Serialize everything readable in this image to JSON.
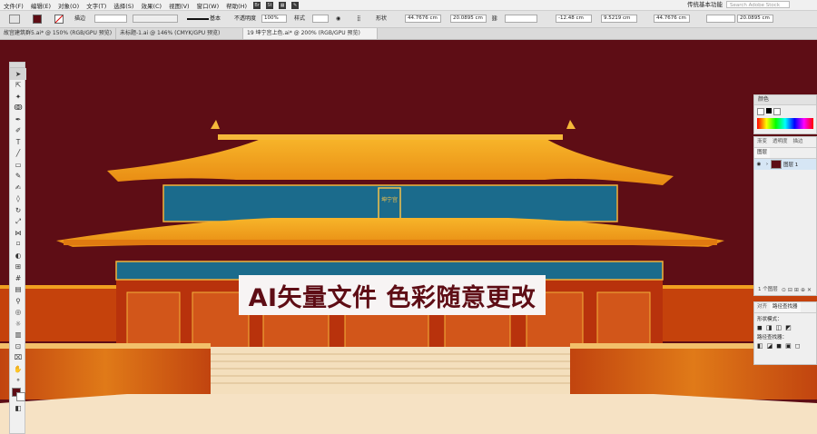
{
  "menu": [
    "文件(F)",
    "编辑(E)",
    "对象(O)",
    "文字(T)",
    "选择(S)",
    "效果(C)",
    "视图(V)",
    "窗口(W)",
    "帮助(H)"
  ],
  "menu_icons": [
    "Br",
    "St"
  ],
  "workspace": "传统基本功能",
  "search_placeholder": "Search Adobe Stock",
  "control": {
    "stroke_label": "描边",
    "stroke_style": "基本",
    "opacity_label": "不透明度",
    "opacity_value": "100%",
    "style_label": "样式",
    "shape_label": "形状",
    "w_value": "44.7676 cm",
    "h_value": "20.0895 cm",
    "angle_value": "-12.48 cm",
    "y_value": "9.5219 cm",
    "w2_value": "44.7676 cm",
    "h2_value": "20.0895 cm"
  },
  "tabs": [
    {
      "label": "故宫建筑群5.ai* @ 150% (RGB/GPU 预览)"
    },
    {
      "label": "未标题-1.ai @ 146% (CMYK/GPU 预览)"
    },
    {
      "label": "19 坤宁宫上色.ai* @ 200% (RGB/GPU 预览)"
    }
  ],
  "plaque_text": "坤宁宫",
  "banner_text": "AI矢量文件 色彩随意更改",
  "panels": {
    "color": {
      "title": "颜色"
    },
    "gradient_tabs": [
      "渐变",
      "透明度",
      "描边"
    ],
    "layers_tab": "图层",
    "layer_name": "图层 1",
    "layer_count": "1 个图层",
    "pathfinder_tabs": [
      "对齐",
      "路径查找器"
    ],
    "shape_modes_label": "形状模式：",
    "pathfinder_label": "路径查找器："
  },
  "colors": {
    "background": "#5e0d15",
    "roof": "#f2a31c",
    "beam": "#1b6b8c",
    "wall": "#b8320c",
    "platform": "#f6e2c4"
  }
}
